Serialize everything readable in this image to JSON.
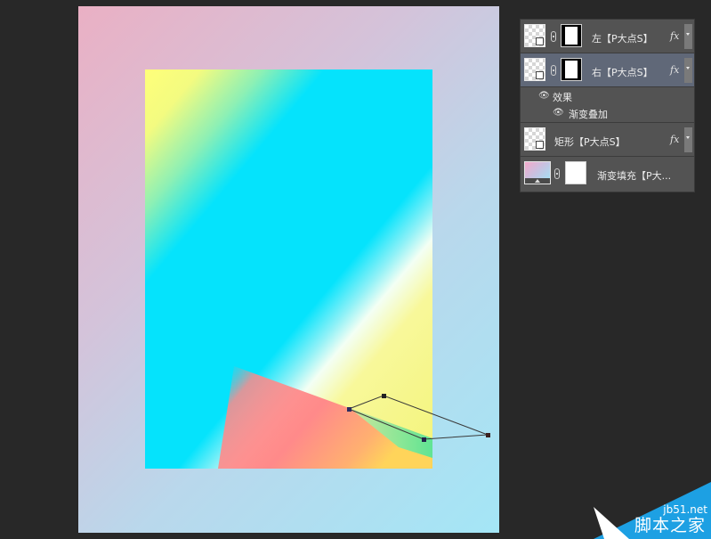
{
  "layers_panel": {
    "layers": [
      {
        "name": "左【P大点S】",
        "fx": "fx"
      },
      {
        "name": "右【P大点S】",
        "fx": "fx"
      },
      {
        "name": "矩形【P大点S】",
        "fx": "fx"
      },
      {
        "name": "渐变填充【P大..."
      }
    ],
    "effects": {
      "title": "效果",
      "items": [
        "渐变叠加"
      ]
    }
  },
  "watermark": {
    "url": "jb51.net",
    "name": "脚本之家"
  },
  "colors": {
    "app_background": "#282828",
    "panel_background": "#535353",
    "selected_layer": "#606878",
    "cyan": "#05e3fc",
    "yellow": "#f8f89a",
    "coral": "#ff8a8a",
    "watermark_blue": "#1da0e3"
  }
}
